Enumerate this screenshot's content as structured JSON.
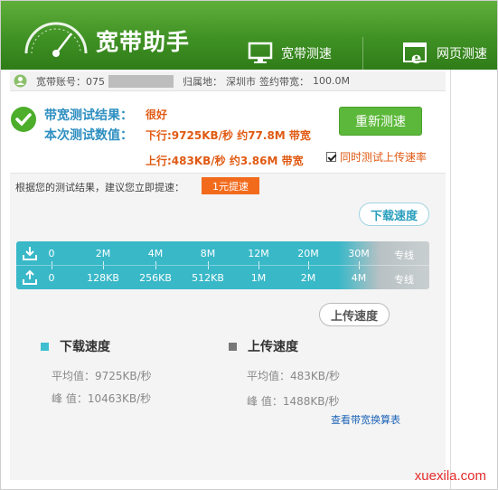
{
  "header": {
    "title": "宽带助手",
    "tabs": [
      {
        "label": "宽带测速",
        "icon": "monitor-icon"
      },
      {
        "label": "网页测速",
        "icon": "ie-browser-icon"
      }
    ],
    "colors": {
      "bar_top": "#5faf3a",
      "bar_bottom": "#2f7c18"
    }
  },
  "account": {
    "account_label": "宽带账号：075",
    "location_label": "归属地：",
    "location_value": "深圳市",
    "bandwidth_label": "签约带宽：",
    "bandwidth_value": "100.0M"
  },
  "result": {
    "result_label": "带宽测试结果：",
    "result_value": "很好",
    "values_label": "本次测试数值：",
    "download_value": "下行:9725KB/秒 约77.8M 带宽",
    "upload_value": "上行:483KB/秒 约3.86M 带宽",
    "retest_button": "重新测速",
    "upload_checkbox_label": "同时测试上传速率",
    "upload_checkbox_checked": true
  },
  "panel": {
    "advice_text": "根据您的测试结果，建议您立即提速：",
    "speedup_button": "1元提速",
    "download_callout": "下载速度",
    "upload_callout": "上传速度",
    "download_scale": [
      "0",
      "2M",
      "4M",
      "8M",
      "12M",
      "20M",
      "30M",
      "专线"
    ],
    "upload_scale": [
      "0",
      "128KB",
      "256KB",
      "512KB",
      "1M",
      "2M",
      "4M",
      "专线"
    ],
    "download_legend": "下载速度",
    "upload_legend": "上传速度",
    "download_avg": "平均值：9725KB/秒",
    "download_peak": "峰  值：10463KB/秒",
    "upload_avg": "平均值：483KB/秒",
    "upload_peak": "峰  值：1488KB/秒",
    "calc_link": "查看带宽换算表",
    "colors": {
      "download": "#3ebfd0",
      "upload": "#777777",
      "accent_orange": "#e05a13"
    }
  },
  "watermark": "xuexila.com"
}
